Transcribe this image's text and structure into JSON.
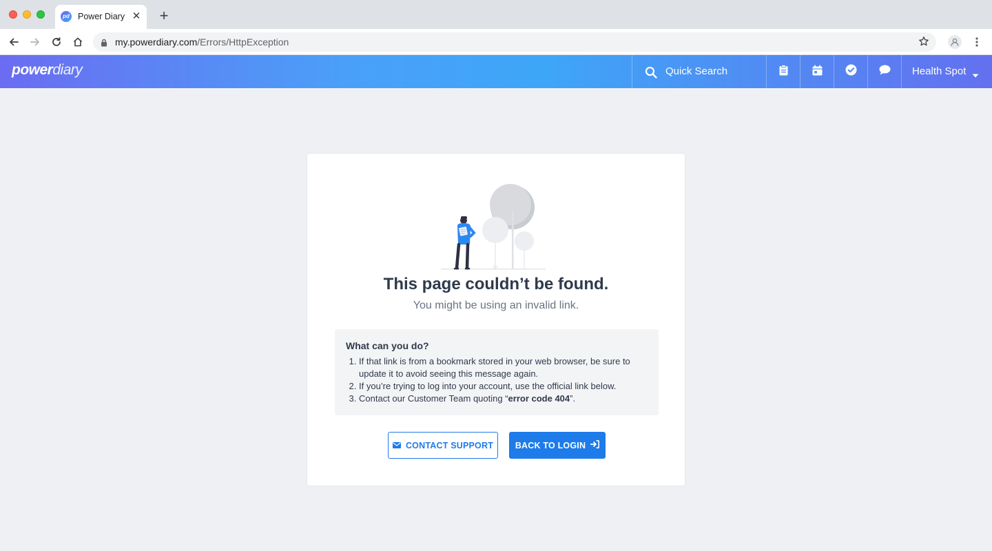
{
  "browser": {
    "tab_title": "Power Diary",
    "favicon_text": "pd",
    "url_host": "my.powerdiary.com",
    "url_path": "/Errors/HttpException"
  },
  "header": {
    "logo_bold": "power",
    "logo_light": "diary",
    "search_label": "Quick Search",
    "account_label": "Health Spot",
    "icons": [
      "clipboard-icon",
      "calendar-icon",
      "check-circle-icon",
      "chat-icon"
    ],
    "gradient_colors": [
      "#6b6cf1",
      "#3ea6f7",
      "#6470ef"
    ]
  },
  "error": {
    "title": "This page couldn’t be found.",
    "subtitle": "You might be using an invalid link.",
    "help_title": "What can you do?",
    "steps": [
      "If that link is from a bookmark stored in your web browser, be sure to update it to avoid seeing this message again.",
      "If you’re trying to log into your account, use the official link below.",
      "Contact our Customer Team quoting “"
    ],
    "error_code": "error code 404",
    "step3_end": "”."
  },
  "actions": {
    "contact_label": "CONTACT SUPPORT",
    "login_label": "BACK TO LOGIN"
  },
  "colors": {
    "accent": "#1d7bea",
    "page_bg": "#eef0f4",
    "heading": "#2f3a4b"
  }
}
